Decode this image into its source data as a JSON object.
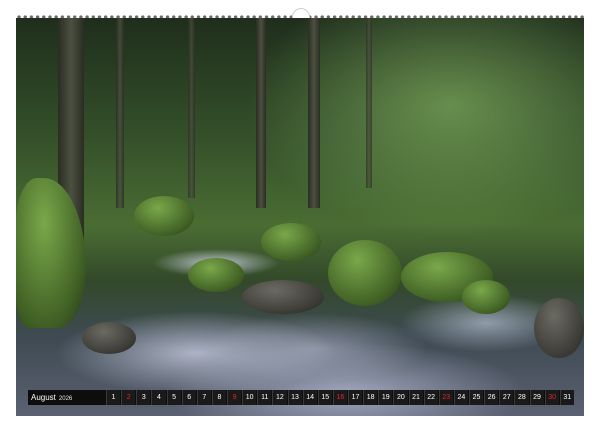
{
  "calendar": {
    "month": "August",
    "year": "2026",
    "days": [
      {
        "label": "1",
        "sunday": false
      },
      {
        "label": "2",
        "sunday": true
      },
      {
        "label": "3",
        "sunday": false
      },
      {
        "label": "4",
        "sunday": false
      },
      {
        "label": "5",
        "sunday": false
      },
      {
        "label": "6",
        "sunday": false
      },
      {
        "label": "7",
        "sunday": false
      },
      {
        "label": "8",
        "sunday": false
      },
      {
        "label": "9",
        "sunday": true
      },
      {
        "label": "10",
        "sunday": false
      },
      {
        "label": "11",
        "sunday": false
      },
      {
        "label": "12",
        "sunday": false
      },
      {
        "label": "13",
        "sunday": false
      },
      {
        "label": "14",
        "sunday": false
      },
      {
        "label": "15",
        "sunday": false
      },
      {
        "label": "16",
        "sunday": true
      },
      {
        "label": "17",
        "sunday": false
      },
      {
        "label": "18",
        "sunday": false
      },
      {
        "label": "19",
        "sunday": false
      },
      {
        "label": "20",
        "sunday": false
      },
      {
        "label": "21",
        "sunday": false
      },
      {
        "label": "22",
        "sunday": false
      },
      {
        "label": "23",
        "sunday": true
      },
      {
        "label": "24",
        "sunday": false
      },
      {
        "label": "25",
        "sunday": false
      },
      {
        "label": "26",
        "sunday": false
      },
      {
        "label": "27",
        "sunday": false
      },
      {
        "label": "28",
        "sunday": false
      },
      {
        "label": "29",
        "sunday": false
      },
      {
        "label": "30",
        "sunday": true
      },
      {
        "label": "31",
        "sunday": false
      }
    ],
    "sunday_color": "#e0252a"
  },
  "photo": {
    "subject": "mossy forest stream with long-exposure water",
    "palette": [
      "#1f2e1c",
      "#4a6d33",
      "#7aa84a",
      "#c8cce0"
    ]
  }
}
